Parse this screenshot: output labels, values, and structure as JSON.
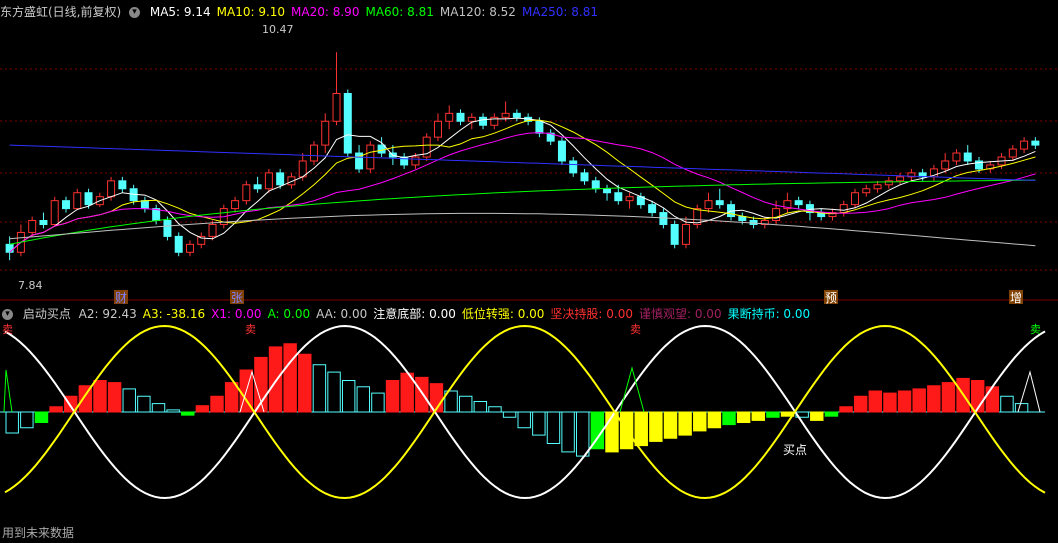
{
  "main_header": {
    "title": "东方盛虹(日线,前复权)",
    "indicators": [
      {
        "label": "MA5:",
        "value": "9.14",
        "color": "#ffffff"
      },
      {
        "label": "MA10:",
        "value": "9.10",
        "color": "#ffff00"
      },
      {
        "label": "MA20:",
        "value": "8.90",
        "color": "#ff00ff"
      },
      {
        "label": "MA60:",
        "value": "8.81",
        "color": "#00ff00"
      },
      {
        "label": "MA120:",
        "value": "8.52",
        "color": "#c0c0c0"
      },
      {
        "label": "MA250:",
        "value": "8.81",
        "color": "#3030ff"
      }
    ]
  },
  "price_labels": {
    "high": "10.47",
    "low": "7.84"
  },
  "event_markers": [
    "财",
    "张",
    "预",
    "增"
  ],
  "sub_header": {
    "title": "启动买点",
    "indicators": [
      {
        "label": "A2:",
        "value": "92.43",
        "color": "#c8c8c8"
      },
      {
        "label": "A3:",
        "value": "-38.16",
        "color": "#ffff00"
      },
      {
        "label": "X1:",
        "value": "0.00",
        "color": "#ff00ff"
      },
      {
        "label": "A:",
        "value": "0.00",
        "color": "#00ff00"
      },
      {
        "label": "AA:",
        "value": "0.00",
        "color": "#c8c8c8"
      },
      {
        "label": "注意底部:",
        "value": "0.00",
        "color": "#ffffff"
      },
      {
        "label": "低位转强:",
        "value": "0.00",
        "color": "#ffff00"
      },
      {
        "label": "坚决持股:",
        "value": "0.00",
        "color": "#ff3030"
      },
      {
        "label": "谨慎观望:",
        "value": "0.00",
        "color": "#a02060"
      },
      {
        "label": "果断持币:",
        "value": "0.00",
        "color": "#00ffff"
      }
    ]
  },
  "sub_markers": [
    "卖",
    "卖",
    "卖",
    "卖"
  ],
  "buy_label": "买点",
  "footer_note": "用到未来数据",
  "colors": {
    "up": "#ff3232",
    "down": "#54ffff",
    "ma5": "#ffffff",
    "ma10": "#ffff00",
    "ma20": "#ff00ff",
    "ma60": "#00ff00",
    "ma120": "#c0c0c0",
    "ma250": "#3030ff",
    "grid": "#800000"
  },
  "chart_data": {
    "type": "candlestick",
    "price_ylim": [
      7.5,
      10.8
    ],
    "candles": [
      [
        8.05,
        7.95,
        8.15,
        7.85
      ],
      [
        7.95,
        8.2,
        8.3,
        7.9
      ],
      [
        8.2,
        8.35,
        8.4,
        8.15
      ],
      [
        8.35,
        8.3,
        8.45,
        8.25
      ],
      [
        8.3,
        8.6,
        8.65,
        8.28
      ],
      [
        8.6,
        8.5,
        8.65,
        8.45
      ],
      [
        8.5,
        8.7,
        8.75,
        8.48
      ],
      [
        8.7,
        8.55,
        8.75,
        8.5
      ],
      [
        8.55,
        8.65,
        8.7,
        8.52
      ],
      [
        8.65,
        8.85,
        8.9,
        8.6
      ],
      [
        8.85,
        8.75,
        8.9,
        8.7
      ],
      [
        8.75,
        8.6,
        8.8,
        8.55
      ],
      [
        8.6,
        8.5,
        8.65,
        8.45
      ],
      [
        8.5,
        8.35,
        8.55,
        8.3
      ],
      [
        8.35,
        8.15,
        8.4,
        8.1
      ],
      [
        8.15,
        7.95,
        8.2,
        7.9
      ],
      [
        7.95,
        8.05,
        8.1,
        7.9
      ],
      [
        8.05,
        8.15,
        8.2,
        8.0
      ],
      [
        8.15,
        8.3,
        8.35,
        8.1
      ],
      [
        8.3,
        8.5,
        8.55,
        8.25
      ],
      [
        8.5,
        8.6,
        8.65,
        8.45
      ],
      [
        8.6,
        8.8,
        8.85,
        8.55
      ],
      [
        8.8,
        8.75,
        8.9,
        8.7
      ],
      [
        8.75,
        8.95,
        9.0,
        8.7
      ],
      [
        8.95,
        8.8,
        9.0,
        8.75
      ],
      [
        8.8,
        8.9,
        8.95,
        8.75
      ],
      [
        8.9,
        9.1,
        9.2,
        8.85
      ],
      [
        9.1,
        9.3,
        9.35,
        9.05
      ],
      [
        9.3,
        9.6,
        9.7,
        9.2
      ],
      [
        9.6,
        9.95,
        10.47,
        9.55
      ],
      [
        9.95,
        9.2,
        10.0,
        9.15
      ],
      [
        9.2,
        9.0,
        9.3,
        8.95
      ],
      [
        9.0,
        9.3,
        9.35,
        8.95
      ],
      [
        9.3,
        9.2,
        9.4,
        9.15
      ],
      [
        9.2,
        9.15,
        9.3,
        9.05
      ],
      [
        9.15,
        9.05,
        9.2,
        9.0
      ],
      [
        9.05,
        9.15,
        9.2,
        9.0
      ],
      [
        9.15,
        9.4,
        9.45,
        9.1
      ],
      [
        9.4,
        9.6,
        9.7,
        9.35
      ],
      [
        9.6,
        9.7,
        9.8,
        9.5
      ],
      [
        9.7,
        9.6,
        9.75,
        9.55
      ],
      [
        9.6,
        9.65,
        9.7,
        9.5
      ],
      [
        9.65,
        9.55,
        9.7,
        9.5
      ],
      [
        9.55,
        9.65,
        9.7,
        9.5
      ],
      [
        9.65,
        9.7,
        9.85,
        9.6
      ],
      [
        9.7,
        9.65,
        9.75,
        9.6
      ],
      [
        9.65,
        9.6,
        9.7,
        9.55
      ],
      [
        9.6,
        9.45,
        9.65,
        9.4
      ],
      [
        9.45,
        9.35,
        9.5,
        9.3
      ],
      [
        9.35,
        9.1,
        9.4,
        9.05
      ],
      [
        9.1,
        8.95,
        9.15,
        8.9
      ],
      [
        8.95,
        8.85,
        9.0,
        8.8
      ],
      [
        8.85,
        8.75,
        8.9,
        8.7
      ],
      [
        8.75,
        8.7,
        8.8,
        8.6
      ],
      [
        8.7,
        8.6,
        8.8,
        8.55
      ],
      [
        8.6,
        8.65,
        8.7,
        8.5
      ],
      [
        8.65,
        8.55,
        8.7,
        8.5
      ],
      [
        8.55,
        8.45,
        8.6,
        8.4
      ],
      [
        8.45,
        8.3,
        8.5,
        8.25
      ],
      [
        8.3,
        8.05,
        8.35,
        8.0
      ],
      [
        8.05,
        8.3,
        8.4,
        8.0
      ],
      [
        8.3,
        8.5,
        8.55,
        8.25
      ],
      [
        8.5,
        8.6,
        8.7,
        8.45
      ],
      [
        8.6,
        8.55,
        8.75,
        8.5
      ],
      [
        8.55,
        8.4,
        8.6,
        8.35
      ],
      [
        8.4,
        8.35,
        8.45,
        8.3
      ],
      [
        8.35,
        8.3,
        8.4,
        8.25
      ],
      [
        8.3,
        8.35,
        8.4,
        8.25
      ],
      [
        8.35,
        8.5,
        8.6,
        8.3
      ],
      [
        8.5,
        8.6,
        8.7,
        8.45
      ],
      [
        8.6,
        8.55,
        8.65,
        8.5
      ],
      [
        8.55,
        8.45,
        8.6,
        8.35
      ],
      [
        8.45,
        8.4,
        8.5,
        8.35
      ],
      [
        8.4,
        8.45,
        8.5,
        8.35
      ],
      [
        8.45,
        8.55,
        8.6,
        8.4
      ],
      [
        8.55,
        8.7,
        8.75,
        8.5
      ],
      [
        8.7,
        8.75,
        8.8,
        8.65
      ],
      [
        8.75,
        8.8,
        8.85,
        8.7
      ],
      [
        8.8,
        8.85,
        8.9,
        8.75
      ],
      [
        8.85,
        8.9,
        8.95,
        8.8
      ],
      [
        8.9,
        8.95,
        9.0,
        8.85
      ],
      [
        8.95,
        8.9,
        9.0,
        8.85
      ],
      [
        8.9,
        9.0,
        9.05,
        8.85
      ],
      [
        9.0,
        9.1,
        9.2,
        8.95
      ],
      [
        9.1,
        9.2,
        9.25,
        9.05
      ],
      [
        9.2,
        9.1,
        9.3,
        9.05
      ],
      [
        9.1,
        9.0,
        9.15,
        8.95
      ],
      [
        9.0,
        9.05,
        9.1,
        8.95
      ],
      [
        9.05,
        9.15,
        9.2,
        9.0
      ],
      [
        9.15,
        9.25,
        9.3,
        9.1
      ],
      [
        9.25,
        9.35,
        9.4,
        9.2
      ],
      [
        9.35,
        9.3,
        9.4,
        9.25
      ]
    ],
    "osc_bars": [
      [
        -20,
        "c"
      ],
      [
        -15,
        "c"
      ],
      [
        -10,
        "g"
      ],
      [
        5,
        "r"
      ],
      [
        15,
        "r"
      ],
      [
        25,
        "r"
      ],
      [
        30,
        "r"
      ],
      [
        28,
        "r"
      ],
      [
        22,
        "c"
      ],
      [
        15,
        "c"
      ],
      [
        8,
        "c"
      ],
      [
        2,
        "c"
      ],
      [
        -3,
        "g"
      ],
      [
        6,
        "r"
      ],
      [
        15,
        "r"
      ],
      [
        28,
        "r"
      ],
      [
        40,
        "r"
      ],
      [
        52,
        "r"
      ],
      [
        62,
        "r"
      ],
      [
        65,
        "r"
      ],
      [
        55,
        "r"
      ],
      [
        45,
        "c"
      ],
      [
        38,
        "c"
      ],
      [
        30,
        "c"
      ],
      [
        24,
        "c"
      ],
      [
        18,
        "c"
      ],
      [
        30,
        "r"
      ],
      [
        37,
        "r"
      ],
      [
        33,
        "r"
      ],
      [
        27,
        "r"
      ],
      [
        20,
        "c"
      ],
      [
        15,
        "c"
      ],
      [
        10,
        "c"
      ],
      [
        5,
        "c"
      ],
      [
        -5,
        "c"
      ],
      [
        -15,
        "c"
      ],
      [
        -22,
        "c"
      ],
      [
        -30,
        "c"
      ],
      [
        -38,
        "c"
      ],
      [
        -42,
        "c"
      ],
      [
        -35,
        "g"
      ],
      [
        -38,
        "y"
      ],
      [
        -35,
        "y"
      ],
      [
        -32,
        "y"
      ],
      [
        -28,
        "y"
      ],
      [
        -25,
        "y"
      ],
      [
        -22,
        "y"
      ],
      [
        -18,
        "y"
      ],
      [
        -15,
        "y"
      ],
      [
        -12,
        "g"
      ],
      [
        -10,
        "y"
      ],
      [
        -8,
        "y"
      ],
      [
        -5,
        "g"
      ],
      [
        -4,
        "y"
      ],
      [
        -5,
        "c"
      ],
      [
        -8,
        "y"
      ],
      [
        -4,
        "g"
      ],
      [
        5,
        "r"
      ],
      [
        15,
        "r"
      ],
      [
        20,
        "r"
      ],
      [
        18,
        "r"
      ],
      [
        20,
        "r"
      ],
      [
        22,
        "r"
      ],
      [
        25,
        "r"
      ],
      [
        28,
        "r"
      ],
      [
        32,
        "r"
      ],
      [
        30,
        "r"
      ],
      [
        24,
        "r"
      ],
      [
        15,
        "c"
      ],
      [
        8,
        "c"
      ]
    ]
  }
}
